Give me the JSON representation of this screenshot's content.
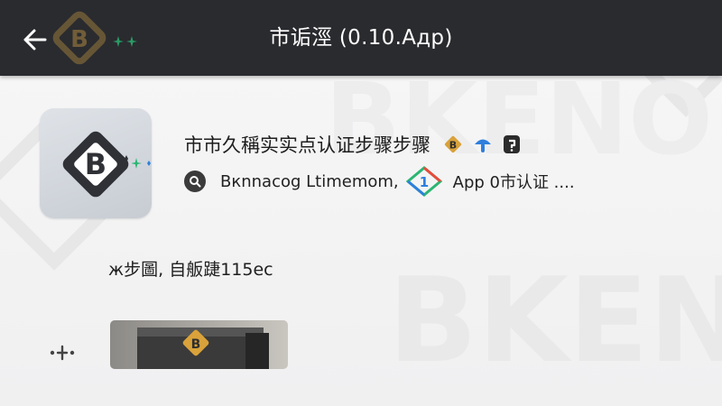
{
  "app_bar": {
    "title": "市诟涇 (0.10.Aдp)"
  },
  "app": {
    "title": "市市久稱实实点认证步骤步骤",
    "developer": "Bкnnacog Ltimemom,",
    "description": "App 0市认证 ...."
  },
  "subline": "ж步圖, 自舨踕115ec",
  "watermark_text": "BKENO",
  "colors": {
    "app_bar_bg": "#2a2b2f",
    "accent_gold": "#d9a23a",
    "accent_blue": "#2e7fdc",
    "sparkle_green": "#2bb673"
  },
  "icons": {
    "back": "arrow-left-icon",
    "search": "search-icon",
    "badge_1": "diamond-logo-icon",
    "badge_2": "pin-icon",
    "badge_3": "shield-icon"
  }
}
